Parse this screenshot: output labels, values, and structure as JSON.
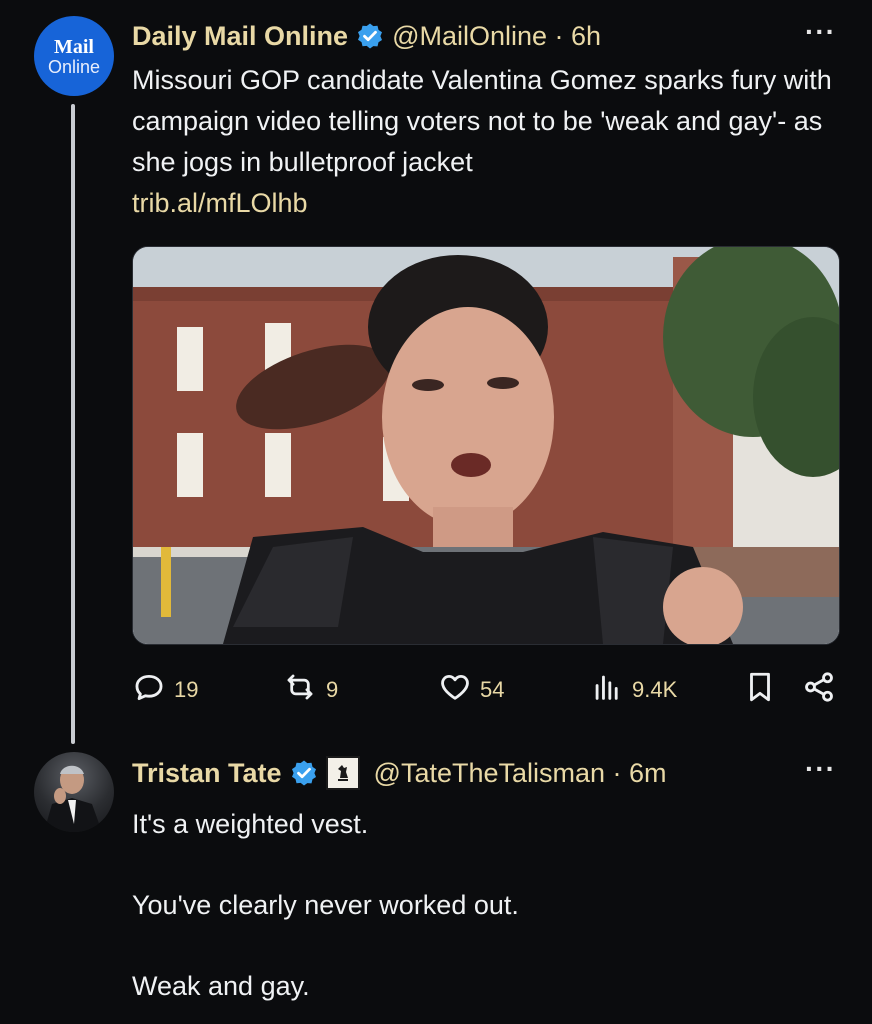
{
  "tweet": {
    "avatar_line1": "Mail",
    "avatar_line2": "Online",
    "name": "Daily Mail Online",
    "handle_time": "@MailOnline · 6h",
    "more": "···",
    "text": "Missouri GOP candidate Valentina Gomez sparks fury with campaign video telling voters not to be 'weak and gay'- as she jogs in bulletproof jacket",
    "link": "trib.al/mfLOlhb",
    "stats": {
      "replies": "19",
      "reposts": "9",
      "likes": "54",
      "views": "9.4K"
    }
  },
  "reply": {
    "name": "Tristan Tate",
    "handle_time": "@TateTheTalisman · 6m",
    "more": "···",
    "line1": "It's a weighted vest.",
    "line2": "You've clearly never worked out.",
    "line3": "Weak and gay."
  },
  "colors": {
    "background": "#0b0c0e",
    "accent": "#e9d9a6",
    "verified": "#3aa0ee"
  },
  "icons": [
    "reply-icon",
    "repost-icon",
    "like-icon",
    "views-icon",
    "bookmark-icon",
    "share-icon",
    "verified-badge-icon",
    "affiliate-badge-icon"
  ]
}
